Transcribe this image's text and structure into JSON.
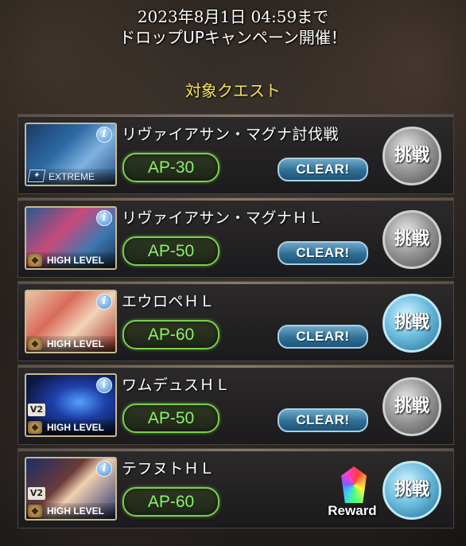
{
  "header": {
    "line1": "2023年8月1日 04:59まで",
    "line2": "ドロップUPキャンペーン開催！"
  },
  "section_title": "対象クエスト",
  "quests": [
    {
      "name": "リヴァイアサン・マグナ討伐戦",
      "level": "EXTREME",
      "version": "",
      "ap": "AP-30",
      "status": "CLEAR!",
      "button": "挑戦",
      "button_style": "grey",
      "reward": ""
    },
    {
      "name": "リヴァイアサン・マグナＨＬ",
      "level": "HIGH LEVEL",
      "version": "",
      "ap": "AP-50",
      "status": "CLEAR!",
      "button": "挑戦",
      "button_style": "grey",
      "reward": ""
    },
    {
      "name": "エウロペＨＬ",
      "level": "HIGH LEVEL",
      "version": "",
      "ap": "AP-60",
      "status": "CLEAR!",
      "button": "挑戦",
      "button_style": "blue",
      "reward": ""
    },
    {
      "name": "ワムデュスＨＬ",
      "level": "HIGH LEVEL",
      "version": "V2",
      "ap": "AP-50",
      "status": "CLEAR!",
      "button": "挑戦",
      "button_style": "grey",
      "reward": ""
    },
    {
      "name": "テフヌトＨＬ",
      "level": "HIGH LEVEL",
      "version": "V2",
      "ap": "AP-60",
      "status": "",
      "button": "挑戦",
      "button_style": "blue",
      "reward": "Reward"
    }
  ],
  "info_icon_glyph": "i",
  "colors": {
    "title_yellow": "#f4e15a",
    "ap_green": "#8cf06a",
    "clear_blue": "#2f6f95"
  }
}
